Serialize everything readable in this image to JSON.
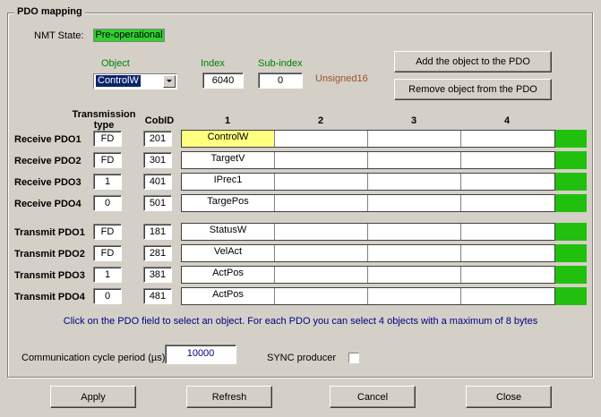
{
  "group_title": "PDO mapping",
  "nmt": {
    "label": "NMT State:",
    "value": "Pre-operational"
  },
  "object": {
    "label": "Object",
    "value": "ControlW"
  },
  "index": {
    "label": "Index",
    "value": "6040"
  },
  "subindex": {
    "label": "Sub-index",
    "value": "0"
  },
  "datatype": "Unsigned16",
  "buttons": {
    "add": "Add the object to the PDO",
    "remove": "Remove object from the PDO",
    "apply": "Apply",
    "refresh": "Refresh",
    "cancel": "Cancel",
    "close": "Close"
  },
  "headers": {
    "trans_line1": "Transmission",
    "trans_line2": "type",
    "cobid": "CobID",
    "c1": "1",
    "c2": "2",
    "c3": "3",
    "c4": "4"
  },
  "rows": [
    {
      "label": "Receive PDO1",
      "type": "FD",
      "cobid": "201",
      "objs": [
        "ControlW",
        "",
        "",
        ""
      ]
    },
    {
      "label": "Receive PDO2",
      "type": "FD",
      "cobid": "301",
      "objs": [
        "TargetV",
        "",
        "",
        ""
      ]
    },
    {
      "label": "Receive PDO3",
      "type": "1",
      "cobid": "401",
      "objs": [
        "IPrec1",
        "",
        "",
        ""
      ]
    },
    {
      "label": "Receive PDO4",
      "type": "0",
      "cobid": "501",
      "objs": [
        "TargePos",
        "",
        "",
        ""
      ]
    },
    {
      "label": "Transmit PDO1",
      "type": "FD",
      "cobid": "181",
      "objs": [
        "StatusW",
        "",
        "",
        ""
      ]
    },
    {
      "label": "Transmit PDO2",
      "type": "FD",
      "cobid": "281",
      "objs": [
        "VelAct",
        "",
        "",
        ""
      ]
    },
    {
      "label": "Transmit PDO3",
      "type": "1",
      "cobid": "381",
      "objs": [
        "ActPos",
        "",
        "",
        ""
      ]
    },
    {
      "label": "Transmit PDO4",
      "type": "0",
      "cobid": "481",
      "objs": [
        "ActPos",
        "",
        "",
        ""
      ]
    }
  ],
  "hint": "Click on the PDO field to select an object. For each PDO you can select 4 objects with a maximum of 8 bytes",
  "cycle": {
    "label": "Communication cycle period (µs):",
    "value": "10000"
  },
  "sync": {
    "label": "SYNC producer",
    "checked": false
  },
  "colors": {
    "selected_cell": "#ffff80",
    "status_ok": "#22c00e",
    "nmt_bg": "#2ed12e"
  }
}
